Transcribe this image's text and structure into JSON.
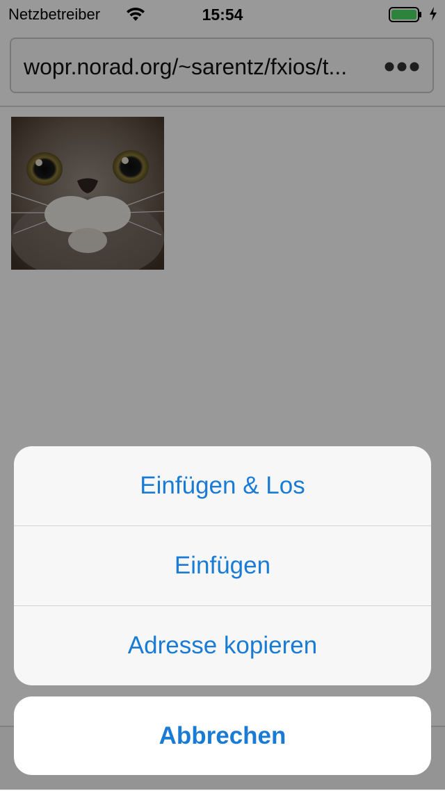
{
  "status_bar": {
    "carrier": "Netzbetreiber",
    "time": "15:54",
    "battery_color": "#4cd964"
  },
  "browser": {
    "url": "wopr.norad.org/~sarentz/fxios/t...",
    "more_icon": "ellipsis-icon",
    "page_image": "cat-photo"
  },
  "action_sheet": {
    "items": [
      {
        "label": "Einfügen & Los"
      },
      {
        "label": "Einfügen"
      },
      {
        "label": "Adresse kopieren"
      }
    ],
    "cancel_label": "Abbrechen",
    "accent_color": "#1a7bd5"
  }
}
